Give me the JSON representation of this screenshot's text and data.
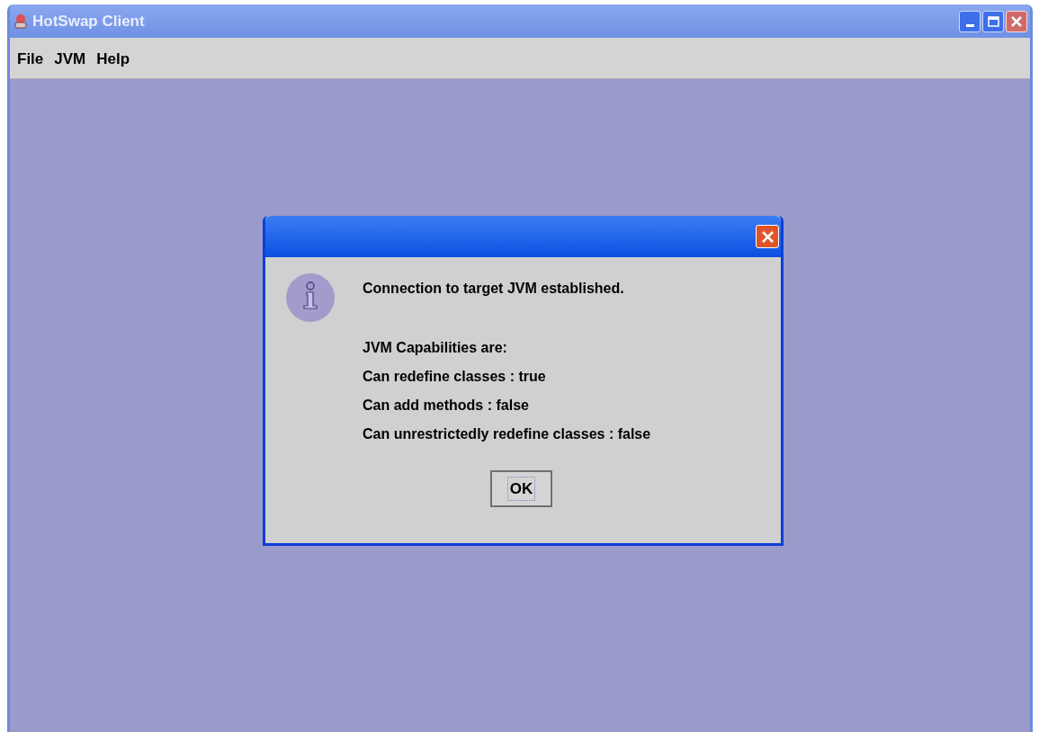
{
  "window": {
    "title": "HotSwap Client"
  },
  "menu": [
    "File",
    "JVM",
    "Help"
  ],
  "dialog": {
    "message": "Connection to target JVM established.",
    "details": [
      "JVM Capabilities are:",
      "Can redefine classes : true",
      "Can add methods : false",
      "Can unrestrictedly redefine classes : false"
    ],
    "button": "OK"
  }
}
